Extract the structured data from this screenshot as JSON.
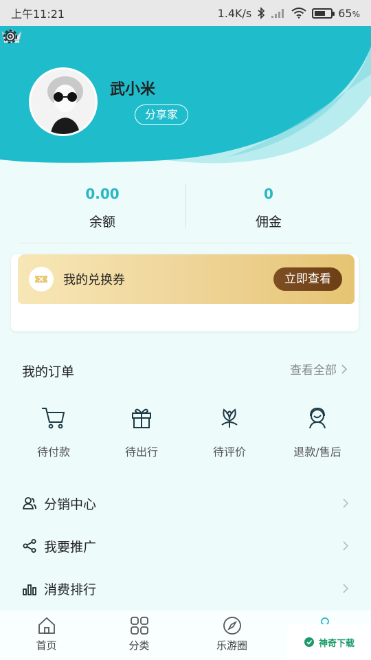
{
  "status_bar": {
    "time": "上午11:21",
    "network_speed": "1.4K/s",
    "battery_percent": "65",
    "battery_unit": "%",
    "battery_level": 0.65
  },
  "profile": {
    "user_name": "武小米",
    "level": "分享家",
    "icons": {
      "settings": "gear-icon",
      "crown": "crown-icon",
      "avatar": "avatar"
    }
  },
  "stats": [
    {
      "value": "0.00",
      "label": "余额"
    },
    {
      "value": "0",
      "label": "佣金"
    }
  ],
  "voucher": {
    "label": "我的兑换券",
    "button": "立即查看"
  },
  "orders": {
    "title": "我的订单",
    "view_all": "查看全部",
    "items": [
      {
        "label": "待付款",
        "icon": "cart-icon"
      },
      {
        "label": "待出行",
        "icon": "gift-icon"
      },
      {
        "label": "待评价",
        "icon": "flower-icon"
      },
      {
        "label": "退款/售后",
        "icon": "service-icon"
      }
    ]
  },
  "menu": [
    {
      "label": "分销中心",
      "icon": "users-icon"
    },
    {
      "label": "我要推广",
      "icon": "share-icon"
    },
    {
      "label": "消费排行",
      "icon": "bar-chart-icon"
    }
  ],
  "bottom_nav": [
    {
      "label": "首页",
      "icon": "home-icon"
    },
    {
      "label": "分类",
      "icon": "grid-icon"
    },
    {
      "label": "乐游圈",
      "icon": "compass-icon"
    },
    {
      "label": "",
      "icon": "user-icon"
    }
  ],
  "watermark": {
    "text": "神奇下载"
  },
  "colors": {
    "accent": "#2ab6c4",
    "header_teal": "#1fbccc",
    "voucher_button": "#7e4e22",
    "background": "#eefbfb"
  }
}
